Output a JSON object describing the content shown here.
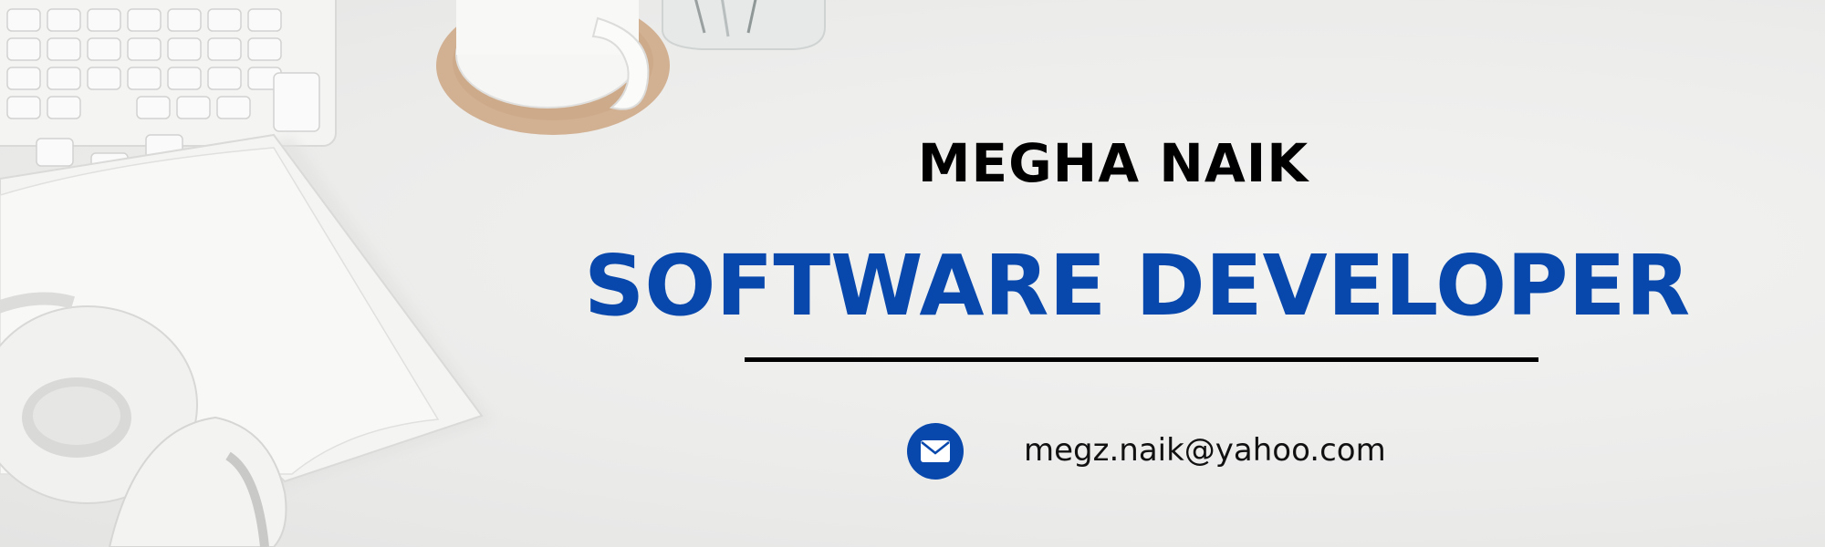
{
  "profile": {
    "name": "MEGHA NAIK",
    "title": "SOFTWARE DEVELOPER",
    "email": "megz.naik@yahoo.com"
  },
  "icons": {
    "email": "envelope-icon"
  },
  "colors": {
    "background": "#ececeb",
    "accent": "#0848ad",
    "text": "#000000"
  }
}
